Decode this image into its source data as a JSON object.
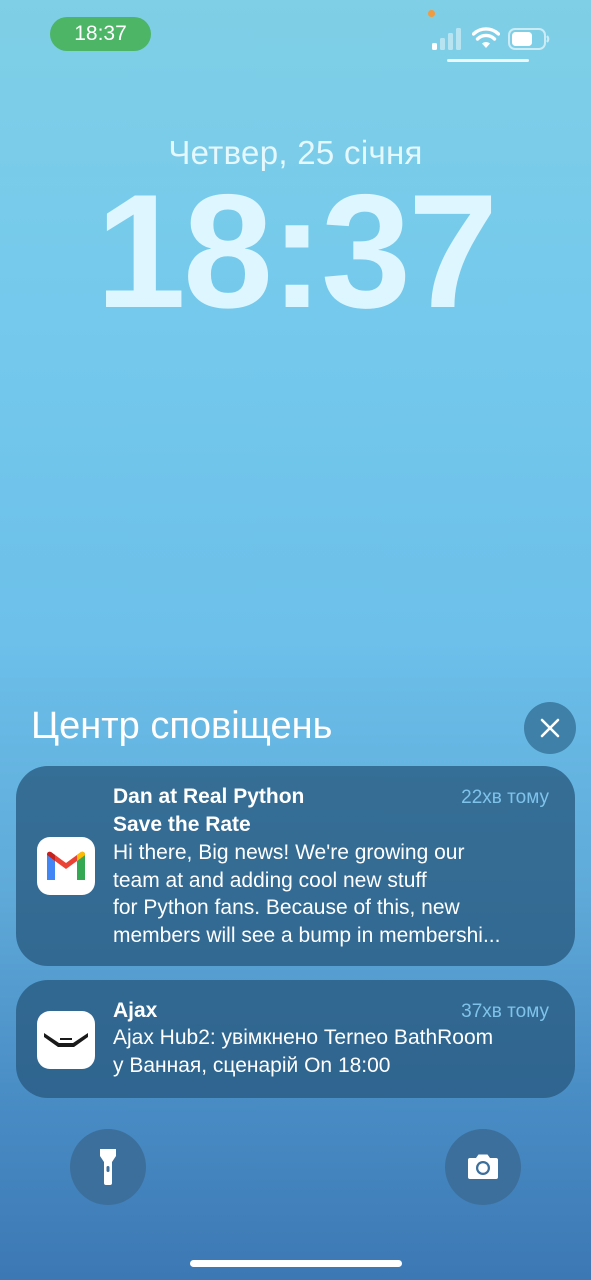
{
  "status_bar": {
    "time": "18:37",
    "icons": [
      "signal-icon",
      "wifi-icon",
      "battery-icon"
    ],
    "pill_color": "#4cb566"
  },
  "lock_screen": {
    "date": "Четвер, 25 січня",
    "time": "18:37"
  },
  "notification_center": {
    "title": "Центр сповіщень",
    "close_icon": "close-icon"
  },
  "notifications": [
    {
      "app_icon": "gmail-icon",
      "sender": "Dan at Real Python",
      "time": "22хв тому",
      "subject": "Save the Rate",
      "body_lines": [
        "Hi there, Big news! We're growing our",
        "team at and adding cool new stuff",
        "for Python fans. Because of this, new",
        "members will see a bump in membershi..."
      ]
    },
    {
      "app_icon": "ajax-icon",
      "sender": "Ajax",
      "time": "37хв тому",
      "body_lines": [
        "Ajax Hub2: увімкнено Terneo BathRoom",
        "у Ванная, сценарій On 18:00"
      ]
    }
  ],
  "bottom_controls": {
    "left": "flashlight-icon",
    "right": "camera-icon"
  },
  "colors": {
    "background_top": "#7fcfe6",
    "background_bottom": "#3c78b4",
    "notification_time": "#7fc3ea"
  }
}
